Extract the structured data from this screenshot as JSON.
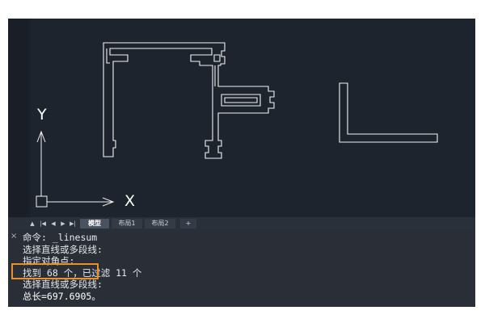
{
  "canvas": {
    "axis_x_label": "X",
    "axis_y_label": "Y"
  },
  "layout_tabs": {
    "nav": [
      "first",
      "prev",
      "next",
      "last"
    ],
    "tabs": [
      "模型",
      "布局1",
      "布局2",
      "+"
    ],
    "active": "模型"
  },
  "command_window": {
    "close_icon": "×",
    "lines": [
      "命令: _linesum",
      "选择直线或多段线:",
      "指定对角点:",
      "找到 68 个，已过滤 11 个",
      "选择直线或多段线:",
      "总长=697.6905。"
    ]
  },
  "colors": {
    "canvas_bg": "#1e242d",
    "command_bg": "#2a2f37",
    "highlight": "#e8902a"
  }
}
